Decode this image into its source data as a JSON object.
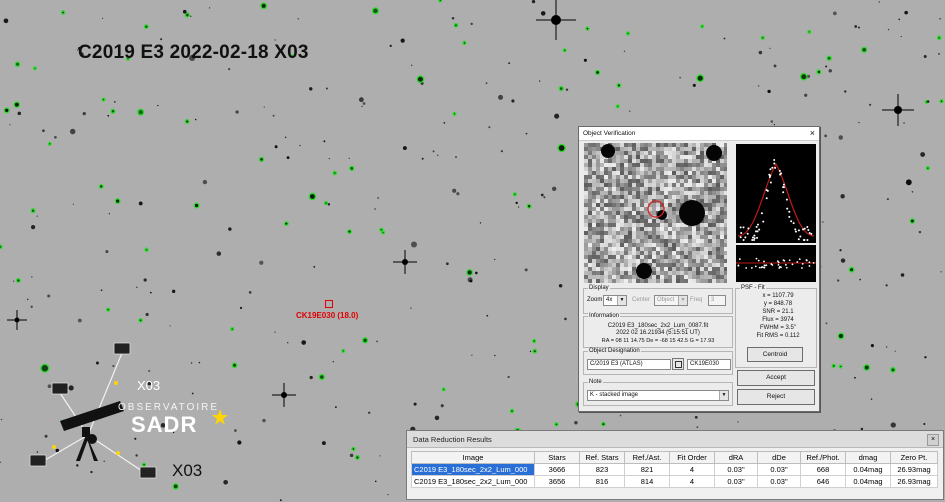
{
  "image_title": "C2019 E3 2022-02-18  X03",
  "comet_label": "CK19E030 (18.0)",
  "logo": {
    "code_small": "X03",
    "code_large": "X03",
    "observatoire": "OBSERVATOIRE",
    "name": "SADR"
  },
  "dialog": {
    "title": "Object Verification",
    "close": "×",
    "display": {
      "legend": "Display",
      "zoom_label": "Zoom",
      "zoom_value": "4x",
      "center_label": "Center",
      "center_value": "Object",
      "freq_label": "Freq",
      "freq_value": "3"
    },
    "information": {
      "legend": "Information",
      "file": "C2019 E3_180sec_2x2_Lum_0087.fit",
      "date": "2022 02 16.21934 (5:15:51 UT)",
      "coords": "RA = 08 11 14.75   De = -68 15 42.5   G = 17.93"
    },
    "designation": {
      "legend": "Object Designation",
      "name_value": "C/2019 E3 (ATLAS)",
      "code_value": "CK19E030"
    },
    "note": {
      "legend": "Note",
      "value": "K - stacked image"
    },
    "psf": {
      "legend": "PSF - Fit",
      "lines": [
        "x = 1107.79",
        "y = 848.78",
        "SNR = 21.1",
        "Flux = 3974",
        "FWHM = 3.5\"",
        "Fit RMS = 0.112"
      ],
      "centroid_button": "Centroid"
    },
    "accept_button": "Accept",
    "reject_button": "Reject"
  },
  "results": {
    "title": "Data Reduction Results",
    "close": "×",
    "columns": [
      "Image",
      "Stars",
      "Ref. Stars",
      "Ref./Ast.",
      "Fit Order",
      "dRA",
      "dDe",
      "Ref./Phot.",
      "dmag",
      "Zero Pt."
    ],
    "rows": [
      [
        "C2019 E3_180sec_2x2_Lum_000",
        "3666",
        "823",
        "821",
        "4",
        "0.03\"",
        "0.03\"",
        "668",
        "0.04mag",
        "26.93mag"
      ],
      [
        "C2019 E3_180sec_2x2_Lum_000",
        "3656",
        "816",
        "814",
        "4",
        "0.03\"",
        "0.03\"",
        "646",
        "0.04mag",
        "26.93mag"
      ]
    ]
  },
  "colors": {
    "sky": "#aeaeae",
    "star_marker": "#22dd22",
    "comet_marker": "#e00000",
    "selection": "#2a6fd6"
  }
}
